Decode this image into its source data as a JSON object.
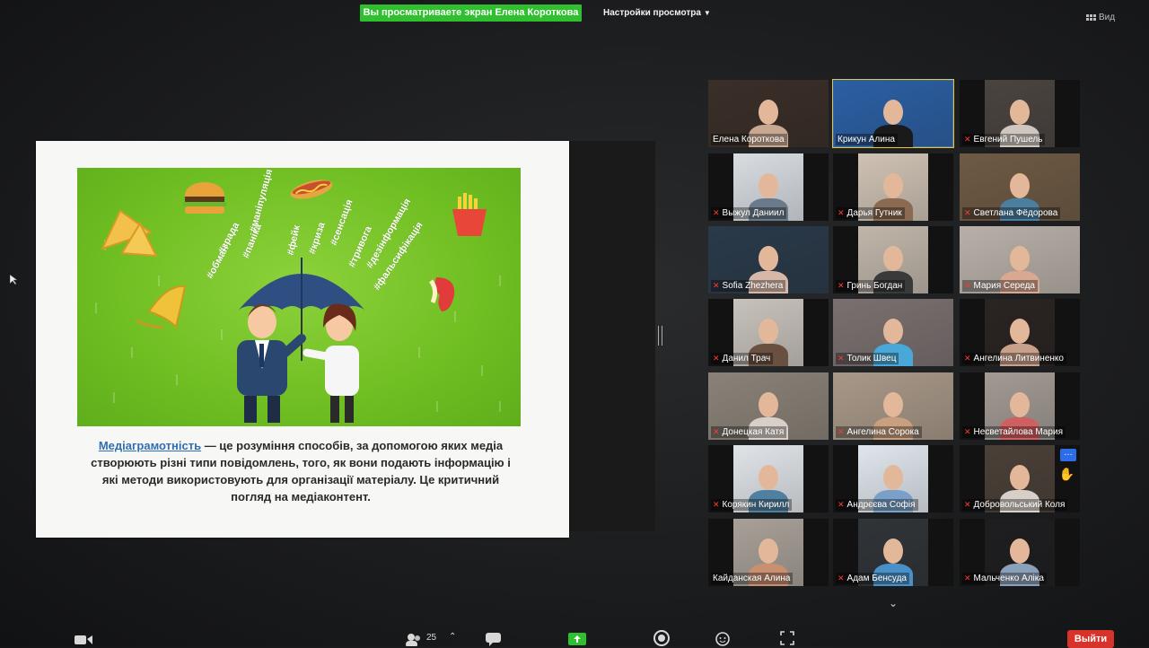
{
  "top_bar": {
    "share_banner": "Вы просматриваете экран Елена Короткова",
    "view_options": "Настройки просмотра",
    "view_toggle": "Вид"
  },
  "slide": {
    "hashtags": [
      "#обман",
      "#зрада",
      "#паніка",
      "#маніпуляція",
      "#фейк",
      "#криза",
      "#сенсація",
      "#тривога",
      "#дезінформація",
      "#фальсифікація"
    ],
    "caption_term": "Медіаграмотність",
    "caption_text": " — це розуміння способів, за допомогою яких медіа створюють різні типи повідомлень, того, як вони подають інформацію і які методи використовують для організації матеріалу. Це критичний погляд на медіаконтент."
  },
  "participants": [
    {
      "name": "Елена Короткова",
      "muted": false
    },
    {
      "name": "Крикун Алина",
      "muted": false,
      "active": true
    },
    {
      "name": "Евгений Пушель",
      "muted": true
    },
    {
      "name": "Выжул Даниил",
      "muted": true
    },
    {
      "name": "Дарья Гутник",
      "muted": true
    },
    {
      "name": "Светлана Фёдорова",
      "muted": true
    },
    {
      "name": "Sofia Zhezhera",
      "muted": true
    },
    {
      "name": "Гринь Богдан",
      "muted": true
    },
    {
      "name": "Мария Середа",
      "muted": true
    },
    {
      "name": "Данил Трач",
      "muted": true
    },
    {
      "name": "Толик Швец",
      "muted": true
    },
    {
      "name": "Ангелина Литвиненко",
      "muted": true
    },
    {
      "name": "Донецкая Катя",
      "muted": true
    },
    {
      "name": "Ангелина Сорока",
      "muted": true
    },
    {
      "name": "Несветайлова Мария",
      "muted": true
    },
    {
      "name": "Корякин Кирилл",
      "muted": true
    },
    {
      "name": "Андрєєва Софія",
      "muted": true
    },
    {
      "name": "Добровольський Коля",
      "muted": true,
      "hand_raised": true
    },
    {
      "name": "Кайданская Алина",
      "muted": false
    },
    {
      "name": "Адам Бенсуда",
      "muted": true
    },
    {
      "name": "Мальченко Аліка",
      "muted": true
    }
  ],
  "toolbar": {
    "participants_count": "25",
    "leave_label": "Выйти"
  },
  "colors": {
    "share_banner": "#2fbf2f",
    "leave_button": "#d8332b",
    "active_speaker_outline": "#e2c64a",
    "muted_icon": "#ff3b30",
    "slide_green": "#6fbe22"
  }
}
